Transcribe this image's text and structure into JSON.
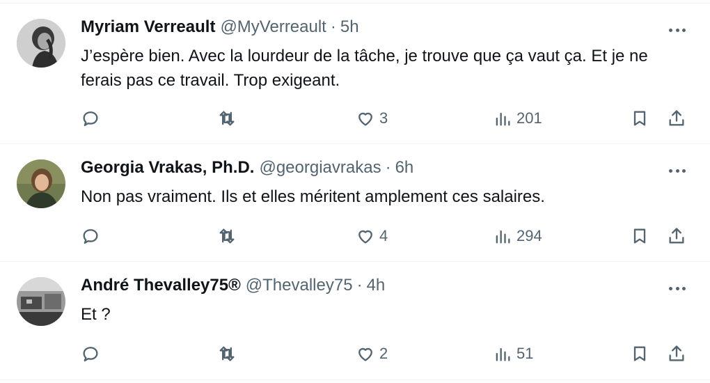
{
  "tweets": [
    {
      "name": "Myriam Verreault",
      "handle": "@MyVerreault",
      "separator": "·",
      "time": "5h",
      "text": "J’espère bien. Avec la lourdeur de la tâche, je trouve que ça vaut ça. Et je ne ferais pas ce travail. Trop exigeant.",
      "likes": "3",
      "views": "201"
    },
    {
      "name": "Georgia Vrakas, Ph.D.",
      "handle": "@georgiavrakas",
      "separator": "·",
      "time": "6h",
      "text": "Non pas vraiment. Ils et elles méritent amplement ces salaires.",
      "likes": "4",
      "views": "294"
    },
    {
      "name": "André Thevalley75®",
      "handle": "@Thevalley75",
      "separator": "·",
      "time": "4h",
      "text": "Et ?",
      "likes": "2",
      "views": "51"
    }
  ],
  "icons": {
    "reply": "reply-icon",
    "retweet": "retweet-icon",
    "like": "like-icon",
    "views": "views-icon",
    "bookmark": "bookmark-icon",
    "share": "share-icon",
    "more": "more-icon"
  },
  "colors": {
    "text": "#0f1419",
    "secondary": "#536471",
    "border": "#eff3f4"
  }
}
